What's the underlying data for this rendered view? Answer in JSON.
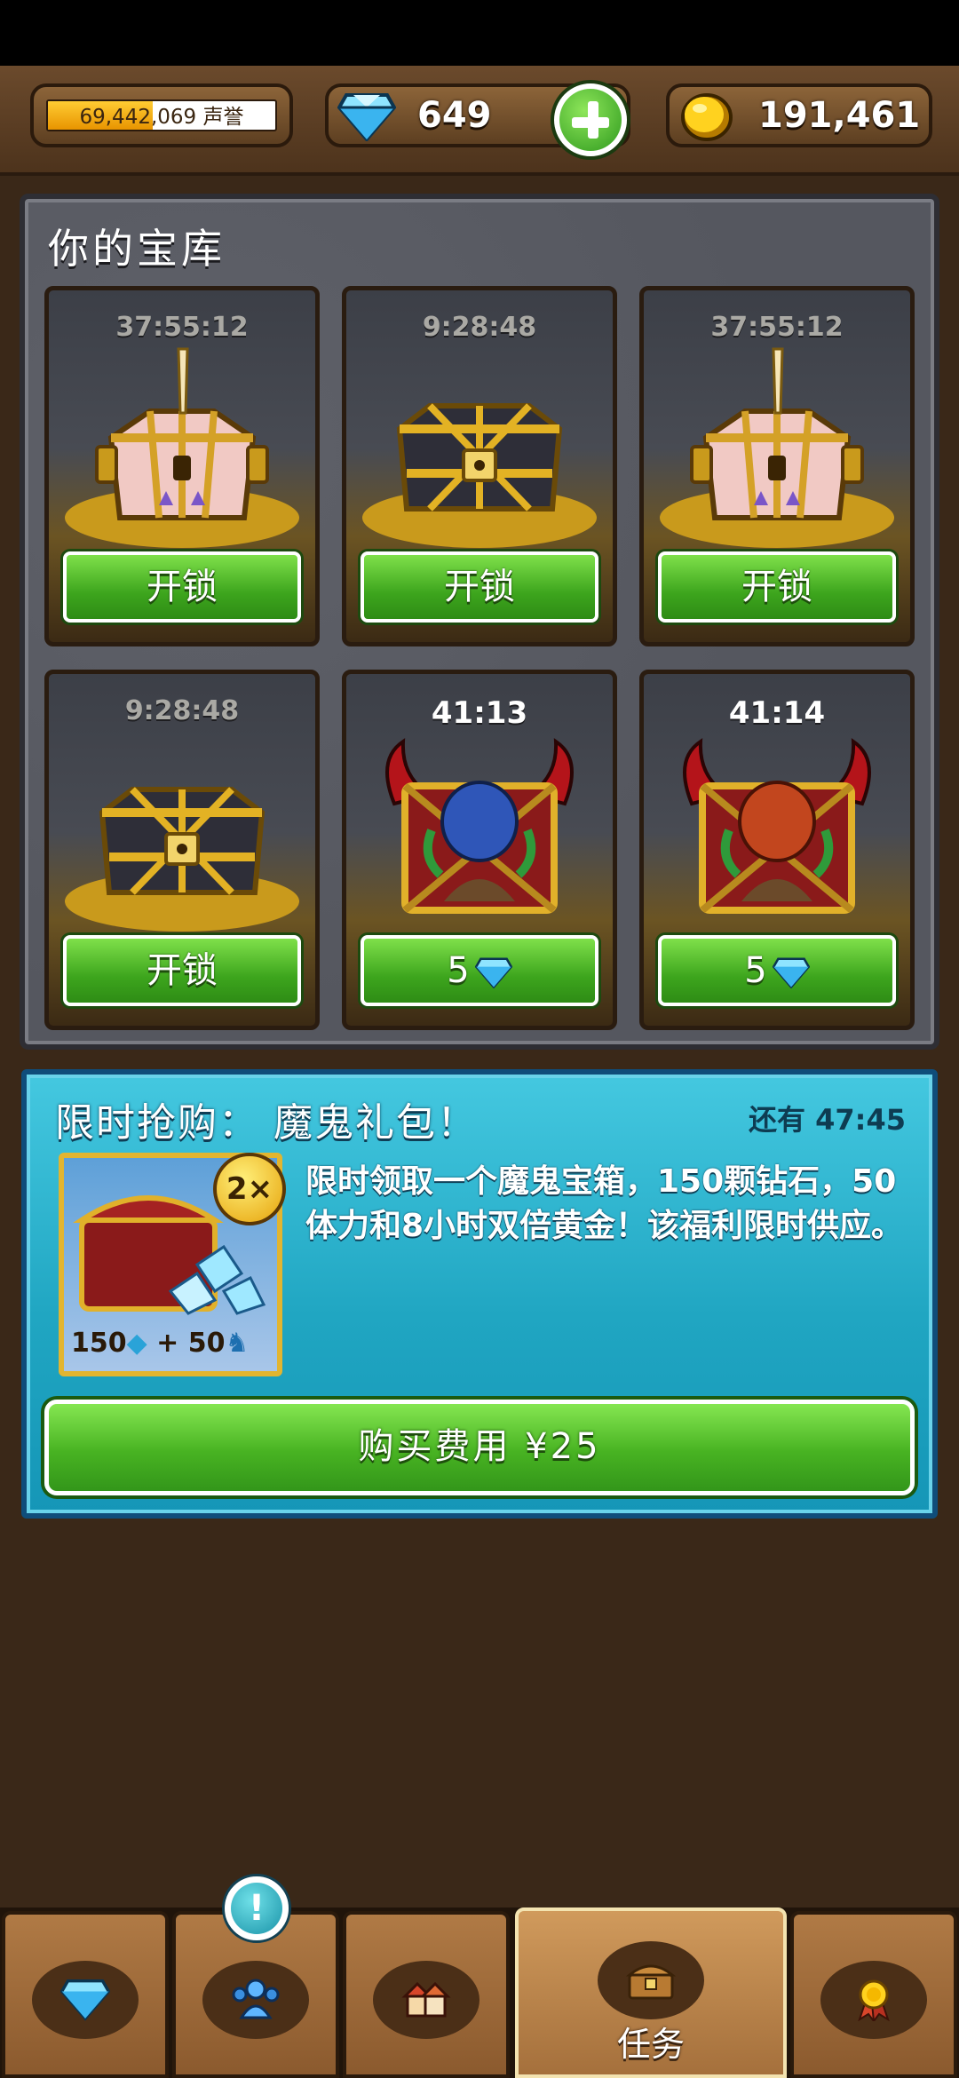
{
  "top_bar": {
    "reputation": {
      "value": "69,442,069",
      "label": "声誉",
      "progress": 0.46
    },
    "gems": {
      "value": "649",
      "icon": "diamond-icon"
    },
    "add_button": {
      "icon": "plus-icon",
      "color": "#3da51d"
    },
    "gold": {
      "value": "191,461",
      "icon": "gold-coin-icon"
    }
  },
  "vault": {
    "title": "你的宝库",
    "cards": [
      {
        "timer": "37:55:12",
        "chest": "unicorn-chest-icon",
        "button": "开锁"
      },
      {
        "timer": "9:28:48",
        "chest": "gold-chest-icon",
        "button": "开锁"
      },
      {
        "timer": "37:55:12",
        "chest": "unicorn-chest-icon",
        "button": "开锁"
      },
      {
        "timer": "9:28:48",
        "chest": "gold-chest-icon",
        "button": "开锁"
      },
      {
        "timer": "41:13",
        "chest": "demon-chest-blue-icon",
        "button": "5"
      },
      {
        "timer": "41:14",
        "chest": "demon-chest-red-icon",
        "button": "5"
      }
    ]
  },
  "offer": {
    "title": "限时抢购： 魔鬼礼包！",
    "timer": "还有 47:45",
    "badge": "2×",
    "contents_gems": "150",
    "contents_plus": "+",
    "contents_stamina": "50",
    "description": "限时领取一个魔鬼宝箱，150颗钻石，50体力和8小时双倍黄金！该福利限时供应。",
    "buy_label": "购买费用 ¥25"
  },
  "bottom_nav": {
    "tabs": [
      {
        "icon": "diamond-icon"
      },
      {
        "icon": "people-icon",
        "alert": "!"
      },
      {
        "icon": "houses-icon"
      },
      {
        "icon": "chest-icon",
        "label": "任务",
        "active": true
      },
      {
        "icon": "medal-icon"
      }
    ]
  },
  "colors": {
    "accent_green": "#48b322",
    "panel_blue": "#20a6c2",
    "wood": "#8b5a2e"
  }
}
